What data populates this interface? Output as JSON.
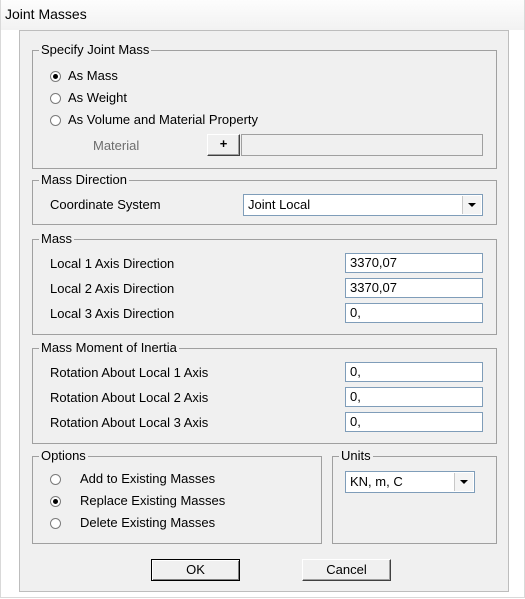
{
  "window": {
    "title": "Joint Masses"
  },
  "specify": {
    "legend": "Specify Joint Mass",
    "options": [
      "As Mass",
      "As Weight",
      "As Volume and Material Property"
    ],
    "selected": 0,
    "material_label": "Material",
    "material_add": "+",
    "material_value": ""
  },
  "direction": {
    "legend": "Mass Direction",
    "coord_label": "Coordinate System",
    "coord_value": "Joint Local"
  },
  "mass": {
    "legend": "Mass",
    "rows": [
      {
        "label": "Local 1 Axis Direction",
        "value": "3370,07"
      },
      {
        "label": "Local 2 Axis Direction",
        "value": "3370,07"
      },
      {
        "label": "Local 3 Axis Direction",
        "value": "0,"
      }
    ]
  },
  "inertia": {
    "legend": "Mass Moment of Inertia",
    "rows": [
      {
        "label": "Rotation About Local 1 Axis",
        "value": "0,"
      },
      {
        "label": "Rotation About Local 2 Axis",
        "value": "0,"
      },
      {
        "label": "Rotation About Local 3 Axis",
        "value": "0,"
      }
    ]
  },
  "options": {
    "legend": "Options",
    "items": [
      "Add to Existing Masses",
      "Replace Existing Masses",
      "Delete Existing Masses"
    ],
    "selected": 1
  },
  "units": {
    "legend": "Units",
    "value": "KN, m, C"
  },
  "buttons": {
    "ok": "OK",
    "cancel": "Cancel"
  }
}
